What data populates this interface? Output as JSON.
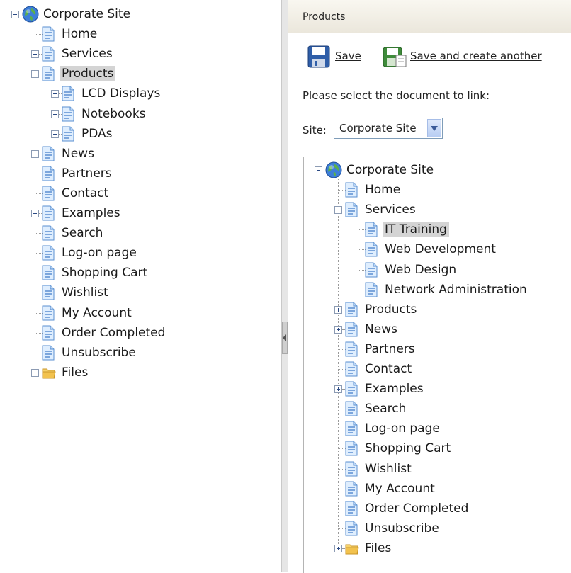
{
  "left_tree": {
    "root": "Corporate Site",
    "items": [
      {
        "label": "Home",
        "level": 1,
        "expander": "none",
        "icon": "page"
      },
      {
        "label": "Services",
        "level": 1,
        "expander": "plus",
        "icon": "page"
      },
      {
        "label": "Products",
        "level": 1,
        "expander": "minus",
        "icon": "page",
        "selected": true
      },
      {
        "label": "LCD Displays",
        "level": 2,
        "expander": "plus",
        "icon": "page"
      },
      {
        "label": "Notebooks",
        "level": 2,
        "expander": "plus",
        "icon": "page"
      },
      {
        "label": "PDAs",
        "level": 2,
        "expander": "plus",
        "icon": "page"
      },
      {
        "label": "News",
        "level": 1,
        "expander": "plus",
        "icon": "page"
      },
      {
        "label": "Partners",
        "level": 1,
        "expander": "none",
        "icon": "page"
      },
      {
        "label": "Contact",
        "level": 1,
        "expander": "none",
        "icon": "page"
      },
      {
        "label": "Examples",
        "level": 1,
        "expander": "plus",
        "icon": "page"
      },
      {
        "label": "Search",
        "level": 1,
        "expander": "none",
        "icon": "page"
      },
      {
        "label": "Log-on page",
        "level": 1,
        "expander": "none",
        "icon": "page"
      },
      {
        "label": "Shopping Cart",
        "level": 1,
        "expander": "none",
        "icon": "page"
      },
      {
        "label": "Wishlist",
        "level": 1,
        "expander": "none",
        "icon": "page"
      },
      {
        "label": "My Account",
        "level": 1,
        "expander": "none",
        "icon": "page"
      },
      {
        "label": "Order Completed",
        "level": 1,
        "expander": "none",
        "icon": "page"
      },
      {
        "label": "Unsubscribe",
        "level": 1,
        "expander": "none",
        "icon": "page"
      },
      {
        "label": "Files",
        "level": 1,
        "expander": "plus",
        "icon": "folder"
      }
    ]
  },
  "right_panel": {
    "header_title": "Products",
    "toolbar": {
      "save_label": "Save",
      "save_another_label": "Save and create another"
    },
    "prompt": "Please select the document to link:",
    "site_label": "Site:",
    "site_value": "Corporate Site"
  },
  "doc_tree": {
    "root": "Corporate Site",
    "items": [
      {
        "label": "Home",
        "level": 1,
        "expander": "none",
        "icon": "page"
      },
      {
        "label": "Services",
        "level": 1,
        "expander": "minus",
        "icon": "page"
      },
      {
        "label": "IT Training",
        "level": 2,
        "expander": "none",
        "icon": "page",
        "selected": true
      },
      {
        "label": "Web Development",
        "level": 2,
        "expander": "none",
        "icon": "page"
      },
      {
        "label": "Web Design",
        "level": 2,
        "expander": "none",
        "icon": "page"
      },
      {
        "label": "Network Administration",
        "level": 2,
        "expander": "none",
        "icon": "page"
      },
      {
        "label": "Products",
        "level": 1,
        "expander": "plus",
        "icon": "page"
      },
      {
        "label": "News",
        "level": 1,
        "expander": "plus",
        "icon": "page"
      },
      {
        "label": "Partners",
        "level": 1,
        "expander": "none",
        "icon": "page"
      },
      {
        "label": "Contact",
        "level": 1,
        "expander": "none",
        "icon": "page"
      },
      {
        "label": "Examples",
        "level": 1,
        "expander": "plus",
        "icon": "page"
      },
      {
        "label": "Search",
        "level": 1,
        "expander": "none",
        "icon": "page"
      },
      {
        "label": "Log-on page",
        "level": 1,
        "expander": "none",
        "icon": "page"
      },
      {
        "label": "Shopping Cart",
        "level": 1,
        "expander": "none",
        "icon": "page"
      },
      {
        "label": "Wishlist",
        "level": 1,
        "expander": "none",
        "icon": "page"
      },
      {
        "label": "My Account",
        "level": 1,
        "expander": "none",
        "icon": "page"
      },
      {
        "label": "Order Completed",
        "level": 1,
        "expander": "none",
        "icon": "page"
      },
      {
        "label": "Unsubscribe",
        "level": 1,
        "expander": "none",
        "icon": "page"
      },
      {
        "label": "Files",
        "level": 1,
        "expander": "plus",
        "icon": "folder"
      }
    ]
  },
  "colors": {
    "selection": "#d4d4d4",
    "header_bg": "#f2efe6",
    "page_icon": "#6fa0dc",
    "folder_icon": "#f2c24e"
  }
}
